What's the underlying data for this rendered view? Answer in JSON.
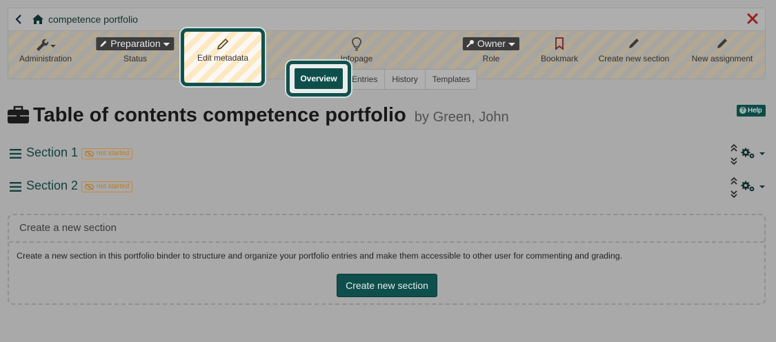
{
  "header": {
    "back_icon": "chevron-left-icon",
    "home_icon": "home-icon",
    "breadcrumb_title": "competence portfolio",
    "close_icon": "close-icon"
  },
  "toolbar": {
    "administration": {
      "label": "Administration",
      "icon": "wrench-icon"
    },
    "status": {
      "value": "Preparation",
      "label": "Status",
      "icon": "pencil-icon"
    },
    "edit_metadata": {
      "label": "Edit metadata",
      "icon": "pencil-icon"
    },
    "infopage": {
      "label": "Infopage",
      "icon": "lightbulb-icon"
    },
    "role": {
      "value": "Owner",
      "label": "Role",
      "icon": "key-icon"
    },
    "bookmark": {
      "label": "Bookmark",
      "icon": "bookmark-icon"
    },
    "create_section": {
      "label": "Create new section",
      "icon": "pencil-icon"
    },
    "new_assignment": {
      "label": "New assignment",
      "icon": "pencil-icon"
    }
  },
  "tabs": [
    {
      "label": "Overview",
      "active": true
    },
    {
      "label": "Entries"
    },
    {
      "label": "History"
    },
    {
      "label": "Templates"
    }
  ],
  "page": {
    "title": "Table of contents competence portfolio",
    "author": "by Green, John",
    "help_label": "Help"
  },
  "sections": [
    {
      "name": "Section 1",
      "status": "not started"
    },
    {
      "name": "Section 2",
      "status": "not started"
    }
  ],
  "create_panel": {
    "heading": "Create a new section",
    "description": "Create a new section in this portfolio binder to structure and organize your portfolio entries and make them accessible to other user for commenting and grading.",
    "button_label": "Create new section"
  },
  "colors": {
    "accent": "#0e4f4b",
    "badge": "#c2883a",
    "close": "#c0392b"
  }
}
